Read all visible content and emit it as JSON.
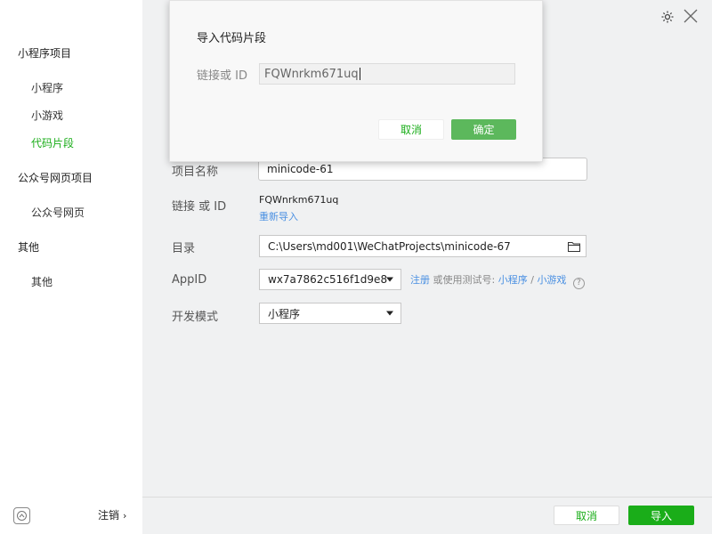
{
  "sidebar": {
    "groups": [
      {
        "label": "小程序项目"
      },
      {
        "label": "公众号网页项目"
      },
      {
        "label": "其他"
      }
    ],
    "items": [
      {
        "label": "小程序"
      },
      {
        "label": "小游戏"
      },
      {
        "label": "代码片段"
      },
      {
        "label": "公众号网页"
      },
      {
        "label": "其他"
      }
    ],
    "logout_label": "注销"
  },
  "form": {
    "project_name_label": "项目名称",
    "project_name_value": "minicode-61",
    "link_label": "链接 或 ID",
    "link_value": "FQWnrkm671uq",
    "reimport_link": "重新导入",
    "dir_label": "目录",
    "dir_value": "C:\\Users\\md001\\WeChatProjects\\minicode-67",
    "appid_label": "AppID",
    "appid_value": "wx7a7862c516f1d9e8",
    "register_link": "注册",
    "or_test_text": "或使用测试号:",
    "miniprogram_link": "小程序",
    "slash": "/",
    "minigame_link": "小游戏",
    "help_glyph": "?",
    "dev_mode_label": "开发模式",
    "dev_mode_value": "小程序"
  },
  "footer": {
    "cancel_label": "取消",
    "import_label": "导入"
  },
  "dialog": {
    "title": "导入代码片段",
    "field_label": "链接或 ID",
    "field_value": "FQWnrkm671uq",
    "cancel_label": "取消",
    "ok_label": "确定"
  },
  "colors": {
    "accent_green": "#1aad19",
    "link_blue": "#4a90e2"
  }
}
